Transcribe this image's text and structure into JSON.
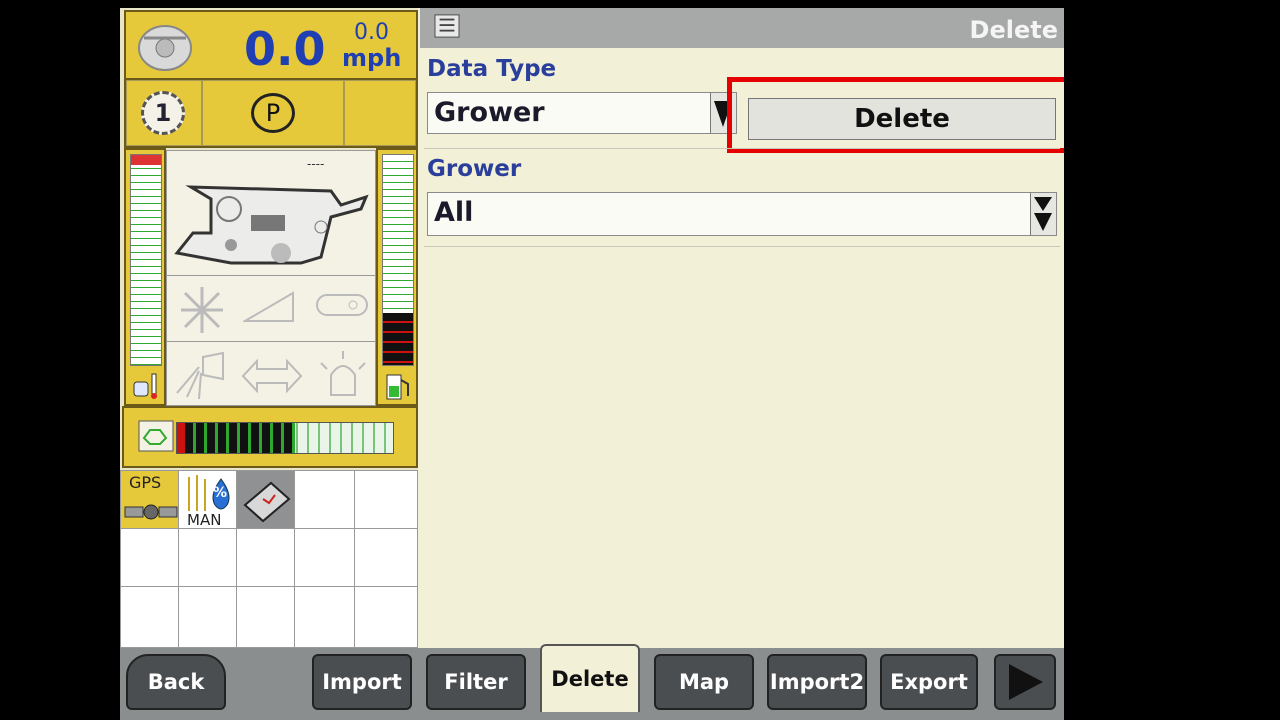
{
  "status_panel": {
    "speed_value": "0.0",
    "speed_small": "0.0",
    "speed_unit": "mph",
    "gear": "1",
    "park": "P",
    "header_dashes": "----",
    "grid_icons": {
      "gps_label": "GPS",
      "man_label": "MAN",
      "percent_symbol": "%"
    }
  },
  "header": {
    "title": "Delete"
  },
  "form": {
    "data_type_label": "Data Type",
    "data_type_value": "Grower",
    "delete_button": "Delete",
    "grower_label": "Grower",
    "grower_value": "All"
  },
  "tabs": [
    {
      "label": "Back"
    },
    {
      "label": "Import"
    },
    {
      "label": "Filter"
    },
    {
      "label": "Delete"
    },
    {
      "label": "Map"
    },
    {
      "label": "Import2"
    },
    {
      "label": "Export"
    }
  ],
  "colors": {
    "accent_yellow": "#e6c93a",
    "speed_blue": "#1f3fb2",
    "label_blue": "#2a3e9b",
    "highlight_red": "#e60000"
  },
  "icons": [
    "combine-icon",
    "fan-icon",
    "header-icon",
    "sieve-icon",
    "lights-icon",
    "unload-icon",
    "beacon-icon",
    "coolant-temp-icon",
    "fuel-icon",
    "engine-load-icon",
    "gps-icon",
    "moisture-icon",
    "data-card-icon",
    "play-arrow-icon",
    "dropdown-arrow-icon"
  ]
}
